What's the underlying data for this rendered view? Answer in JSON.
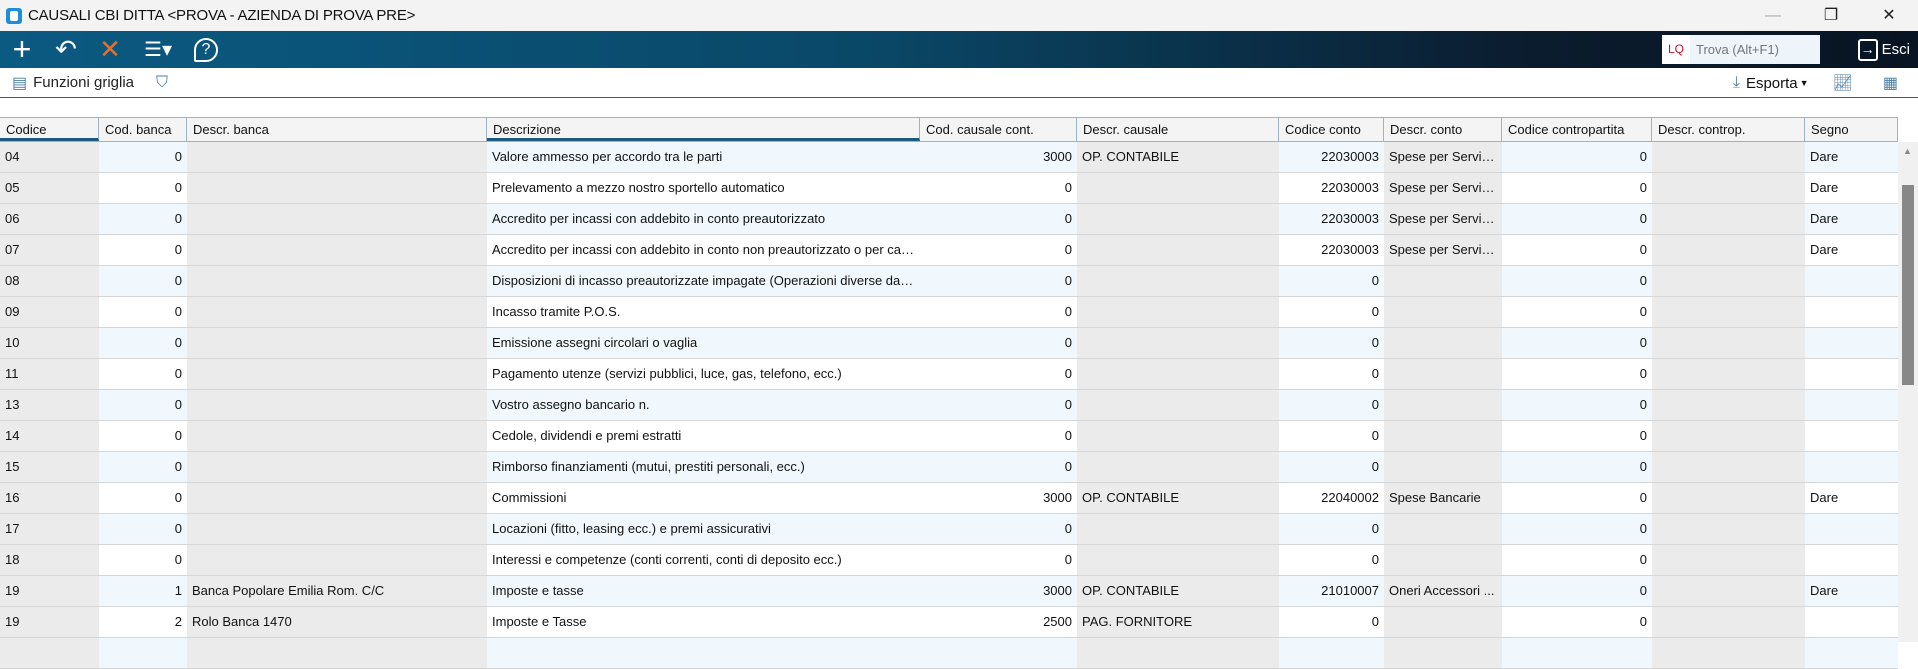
{
  "window": {
    "title": "CAUSALI CBI DITTA <PROVA - AZIENDA DI PROVA PRE>",
    "minimize": "—",
    "maximize": "❐",
    "close": "✕"
  },
  "toolbar": {
    "add": "+",
    "undo": "↶",
    "delete": "✕",
    "menu": "☰▾",
    "help": "?",
    "lq": "LQ",
    "find_placeholder": "Trova (Alt+F1)",
    "exit": "Esci"
  },
  "subbar": {
    "grid_functions": "Funzioni griglia",
    "export": "Esporta"
  },
  "columns": [
    "Codice",
    "Cod. banca",
    "Descr. banca",
    "Descrizione",
    "Cod. causale cont.",
    "Descr. causale",
    "Codice conto",
    "Descr. conto",
    "Codice contropartita",
    "Descr. controp.",
    "Segno"
  ],
  "rows": [
    [
      "04",
      "0",
      "",
      "Valore ammesso per accordo tra le parti",
      "3000",
      "OP. CONTABILE",
      "22030003",
      "Spese per Servizi...",
      "0",
      "",
      "Dare"
    ],
    [
      "05",
      "0",
      "",
      "Prelevamento a mezzo nostro sportello automatico",
      "0",
      "",
      "22030003",
      "Spese per Servizi...",
      "0",
      "",
      "Dare"
    ],
    [
      "06",
      "0",
      "",
      "Accredito per incassi con addebito in conto preautorizzato",
      "0",
      "",
      "22030003",
      "Spese per Servizi...",
      "0",
      "",
      "Dare"
    ],
    [
      "07",
      "0",
      "",
      "Accredito per incassi con addebito in conto non preautorizzato o per cassa",
      "0",
      "",
      "22030003",
      "Spese per Servizi...",
      "0",
      "",
      "Dare"
    ],
    [
      "08",
      "0",
      "",
      "Disposizioni di incasso preautorizzate impagate (Operazioni diverse da i...",
      "0",
      "",
      "0",
      "",
      "0",
      "",
      ""
    ],
    [
      "09",
      "0",
      "",
      "Incasso tramite P.O.S.",
      "0",
      "",
      "0",
      "",
      "0",
      "",
      ""
    ],
    [
      "10",
      "0",
      "",
      "Emissione assegni circolari o vaglia",
      "0",
      "",
      "0",
      "",
      "0",
      "",
      ""
    ],
    [
      "11",
      "0",
      "",
      "Pagamento utenze (servizi pubblici, luce, gas, telefono, ecc.)",
      "0",
      "",
      "0",
      "",
      "0",
      "",
      ""
    ],
    [
      "13",
      "0",
      "",
      "Vostro assegno bancario n.",
      "0",
      "",
      "0",
      "",
      "0",
      "",
      ""
    ],
    [
      "14",
      "0",
      "",
      "Cedole, dividendi e premi estratti",
      "0",
      "",
      "0",
      "",
      "0",
      "",
      ""
    ],
    [
      "15",
      "0",
      "",
      "Rimborso finanziamenti (mutui, prestiti personali, ecc.)",
      "0",
      "",
      "0",
      "",
      "0",
      "",
      ""
    ],
    [
      "16",
      "0",
      "",
      "Commissioni",
      "3000",
      "OP. CONTABILE",
      "22040002",
      "Spese Bancarie",
      "0",
      "",
      "Dare"
    ],
    [
      "17",
      "0",
      "",
      "Locazioni (fitto, leasing ecc.) e premi assicurativi",
      "0",
      "",
      "0",
      "",
      "0",
      "",
      ""
    ],
    [
      "18",
      "0",
      "",
      "Interessi e competenze (conti correnti, conti di deposito ecc.)",
      "0",
      "",
      "0",
      "",
      "0",
      "",
      ""
    ],
    [
      "19",
      "1",
      "Banca Popolare Emilia Rom. C/C",
      "Imposte e tasse",
      "3000",
      "OP. CONTABILE",
      "21010007",
      "Oneri Accessori ...",
      "0",
      "",
      "Dare"
    ],
    [
      "19",
      "2",
      "Rolo Banca 1470",
      "Imposte e Tasse",
      "2500",
      "PAG. FORNITORE",
      "0",
      "",
      "0",
      "",
      ""
    ]
  ]
}
